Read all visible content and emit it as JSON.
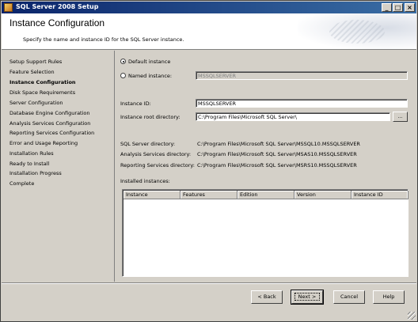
{
  "window": {
    "title": "SQL Server 2008 Setup",
    "minimize": "_",
    "maximize": "□",
    "close": "×"
  },
  "header": {
    "title": "Instance Configuration",
    "subtitle": "Specify the name and instance ID for the SQL Server instance."
  },
  "sidebar": {
    "items": [
      {
        "label": "Setup Support Rules"
      },
      {
        "label": "Feature Selection"
      },
      {
        "label": "Instance Configuration",
        "active": true
      },
      {
        "label": "Disk Space Requirements"
      },
      {
        "label": "Server Configuration"
      },
      {
        "label": "Database Engine Configuration"
      },
      {
        "label": "Analysis Services Configuration"
      },
      {
        "label": "Reporting Services Configuration"
      },
      {
        "label": "Error and Usage Reporting"
      },
      {
        "label": "Installation Rules"
      },
      {
        "label": "Ready to Install"
      },
      {
        "label": "Installation Progress"
      },
      {
        "label": "Complete"
      }
    ]
  },
  "form": {
    "default_instance_label": "Default instance",
    "named_instance_label": "Named instance:",
    "named_instance_value": "MSSQLSERVER",
    "instance_id_label": "Instance ID:",
    "instance_id_value": "MSSQLSERVER",
    "root_dir_label": "Instance root directory:",
    "root_dir_value": "C:\\Program Files\\Microsoft SQL Server\\",
    "browse_label": "...",
    "sql_dir_label": "SQL Server directory:",
    "sql_dir_value": "C:\\Program Files\\Microsoft SQL Server\\MSSQL10.MSSQLSERVER",
    "as_dir_label": "Analysis Services directory:",
    "as_dir_value": "C:\\Program Files\\Microsoft SQL Server\\MSAS10.MSSQLSERVER",
    "rs_dir_label": "Reporting Services directory:",
    "rs_dir_value": "C:\\Program Files\\Microsoft SQL Server\\MSRS10.MSSQLSERVER",
    "installed_label": "Installed instances:"
  },
  "installed_table": {
    "columns": [
      "Instance",
      "Features",
      "Edition",
      "Version",
      "Instance ID"
    ],
    "rows": []
  },
  "buttons": {
    "back": "< Back",
    "next": "Next >",
    "cancel": "Cancel",
    "help": "Help"
  }
}
